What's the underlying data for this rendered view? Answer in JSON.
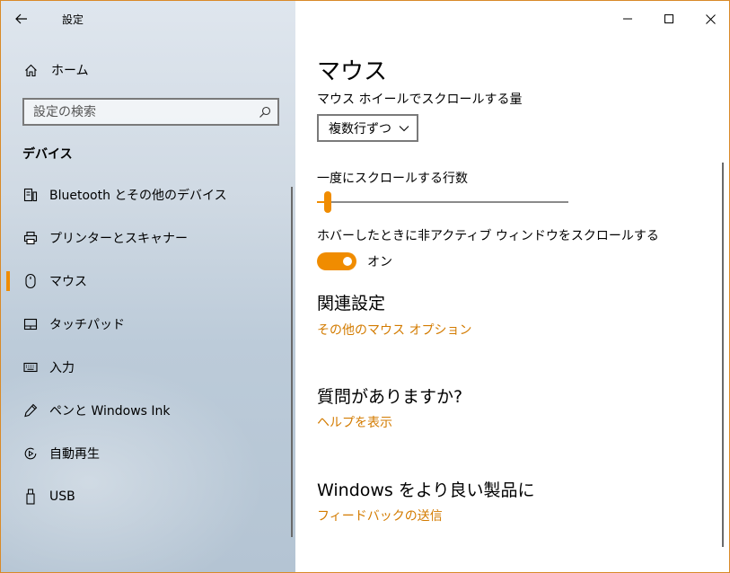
{
  "window": {
    "app_title": "設定",
    "accent": "#f08c00",
    "border": "#d98a28"
  },
  "nav": {
    "home_label": "ホーム",
    "search_placeholder": "設定の検索",
    "section_title": "デバイス",
    "items": [
      {
        "label": "Bluetooth とその他のデバイス",
        "icon": "bluetooth-device-icon"
      },
      {
        "label": "プリンターとスキャナー",
        "icon": "printer-icon"
      },
      {
        "label": "マウス",
        "icon": "mouse-icon",
        "selected": true
      },
      {
        "label": "タッチパッド",
        "icon": "touchpad-icon"
      },
      {
        "label": "入力",
        "icon": "keyboard-icon"
      },
      {
        "label": "ペンと Windows Ink",
        "icon": "pen-icon"
      },
      {
        "label": "自動再生",
        "icon": "autoplay-icon"
      },
      {
        "label": "USB",
        "icon": "usb-icon"
      }
    ]
  },
  "content": {
    "title": "マウス",
    "wheel_label": "マウス ホイールでスクロールする量",
    "wheel_value": "複数行ずつ",
    "lines_label": "一度にスクロールする行数",
    "lines_slider_fraction": 0.03,
    "hover_label": "ホバーしたときに非アクティブ ウィンドウをスクロールする",
    "hover_state": "オン",
    "related_heading": "関連設定",
    "related_link": "その他のマウス オプション",
    "question_heading": "質問がありますか?",
    "help_link": "ヘルプを表示",
    "feedback_heading": "Windows をより良い製品に",
    "feedback_link": "フィードバックの送信"
  }
}
